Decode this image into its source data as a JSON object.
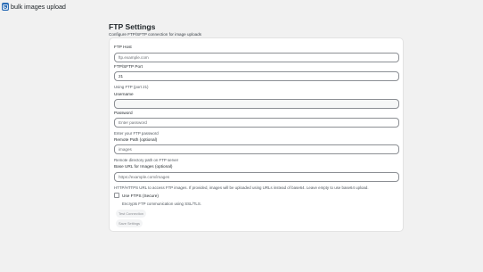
{
  "app": {
    "title": "bulk images upload",
    "brand_color": "#2c6db5"
  },
  "page": {
    "title": "FTP Settings",
    "description": "Configure FTP/SFTP connection for image uploads"
  },
  "form": {
    "host": {
      "label": "FTP Host",
      "placeholder": "ftp.example.com",
      "value": ""
    },
    "port": {
      "label": "FTP/SFTP Port",
      "value": "21",
      "hint": "Using FTP (port 21)"
    },
    "username": {
      "label": "Username",
      "value": ""
    },
    "password": {
      "label": "Password",
      "placeholder": "Enter password",
      "hint": "Enter your FTP password"
    },
    "remote_path": {
      "label": "Remote Path (optional)",
      "placeholder": "images",
      "hint": "Remote directory path on FTP server"
    },
    "base_url": {
      "label": "Base URL for Images (optional)",
      "placeholder": "https://example.com/images",
      "hint": "HTTP/HTTPS URL to access FTP images. If provided, images will be uploaded using URLs instead of base64. Leave empty to use base64 upload."
    },
    "ftps": {
      "label": "Use FTPS (Secure)",
      "hint": "Encrypts FTP communication using SSL/TLS.",
      "checked": false
    }
  },
  "actions": {
    "test_label": "Test Connection",
    "save_label": "Save Settings"
  }
}
